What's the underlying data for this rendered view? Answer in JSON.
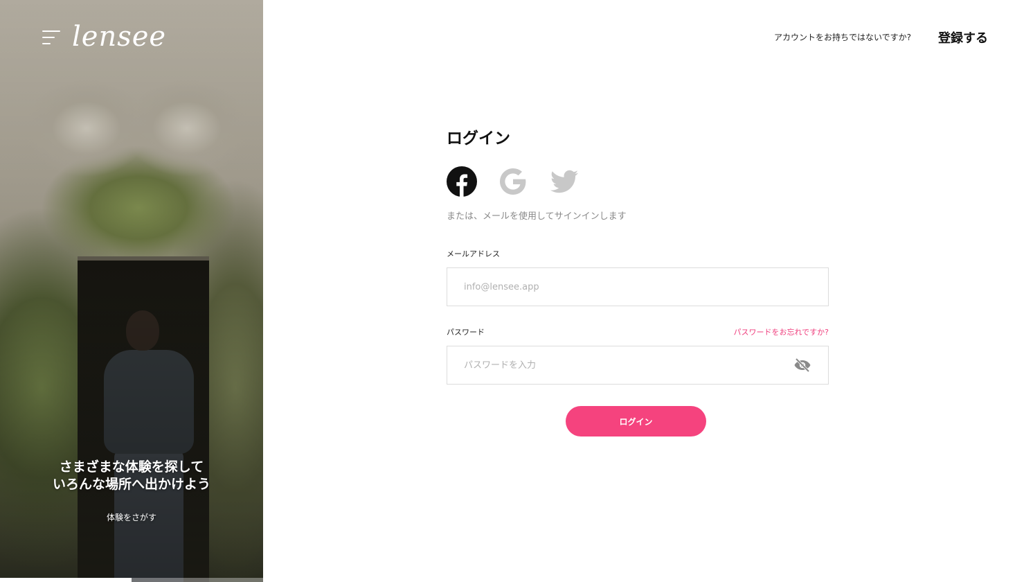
{
  "hero": {
    "logo": "lensee",
    "caption_line1": "さまざまな体験を探して",
    "caption_line2": "いろんな場所へ出かけよう",
    "link": "体験をさがす",
    "progress": 0.5
  },
  "header": {
    "prompt": "アカウントをお持ちではないですか?",
    "register": "登録する"
  },
  "form": {
    "title": "ログイン",
    "social": [
      "facebook-icon",
      "google-icon",
      "twitter-icon"
    ],
    "or_text": "または、メールを使用してサインインします",
    "email_label": "メールアドレス",
    "email_placeholder": "info@lensee.app",
    "password_label": "パスワード",
    "forgot": "パスワードをお忘れですか?",
    "password_placeholder": "パスワードを入力",
    "submit": "ログイン"
  },
  "colors": {
    "accent": "#f5437e",
    "link": "#ef3e7d",
    "muted_icon": "#c8c8c8"
  }
}
